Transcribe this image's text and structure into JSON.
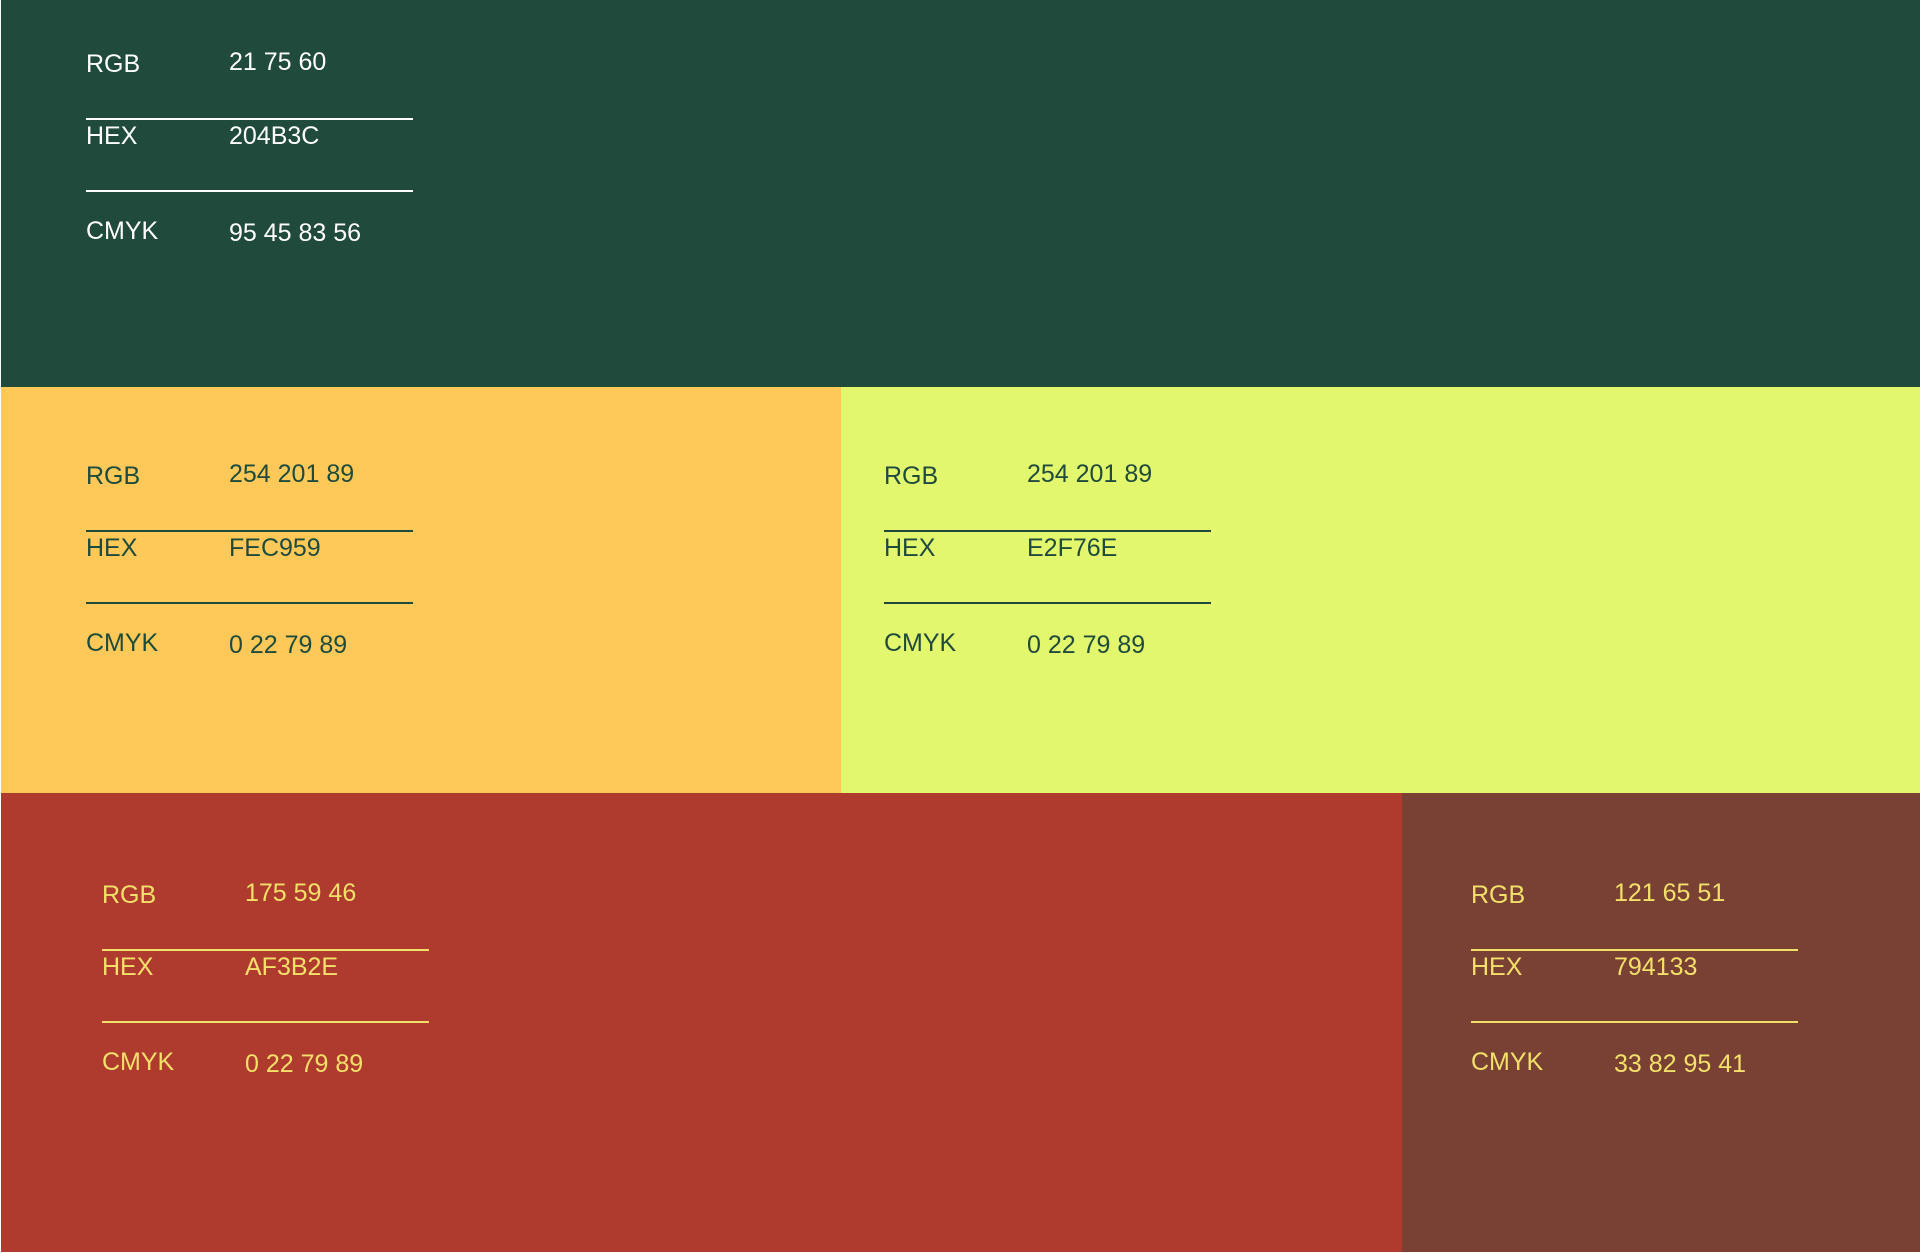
{
  "labels": {
    "rgb": "RGB",
    "hex": "HEX",
    "cmyk": "CMYK"
  },
  "swatches": [
    {
      "color": "#204B3C",
      "text_color": "#FFFFFF",
      "rgb": "21   75  60",
      "hex": "204B3C",
      "cmyk": "95 45 83 56"
    },
    {
      "color": "#FEC959",
      "text_color": "#204B3C",
      "rgb": "254  201  89",
      "hex": "FEC959",
      "cmyk": "0 22 79 89"
    },
    {
      "color": "#E2F76E",
      "text_color": "#204B3C",
      "rgb": "254  201  89",
      "hex": "E2F76E",
      "cmyk": "0 22 79 89"
    },
    {
      "color": "#AF3B2E",
      "text_color": "#F3E06A",
      "rgb": "175 59  46",
      "hex": "AF3B2E",
      "cmyk": "0 22 79 89"
    },
    {
      "color": "#794133",
      "text_color": "#F3E06A",
      "rgb": "121  65  51",
      "hex": "794133",
      "cmyk": "33 82 95 41"
    }
  ]
}
